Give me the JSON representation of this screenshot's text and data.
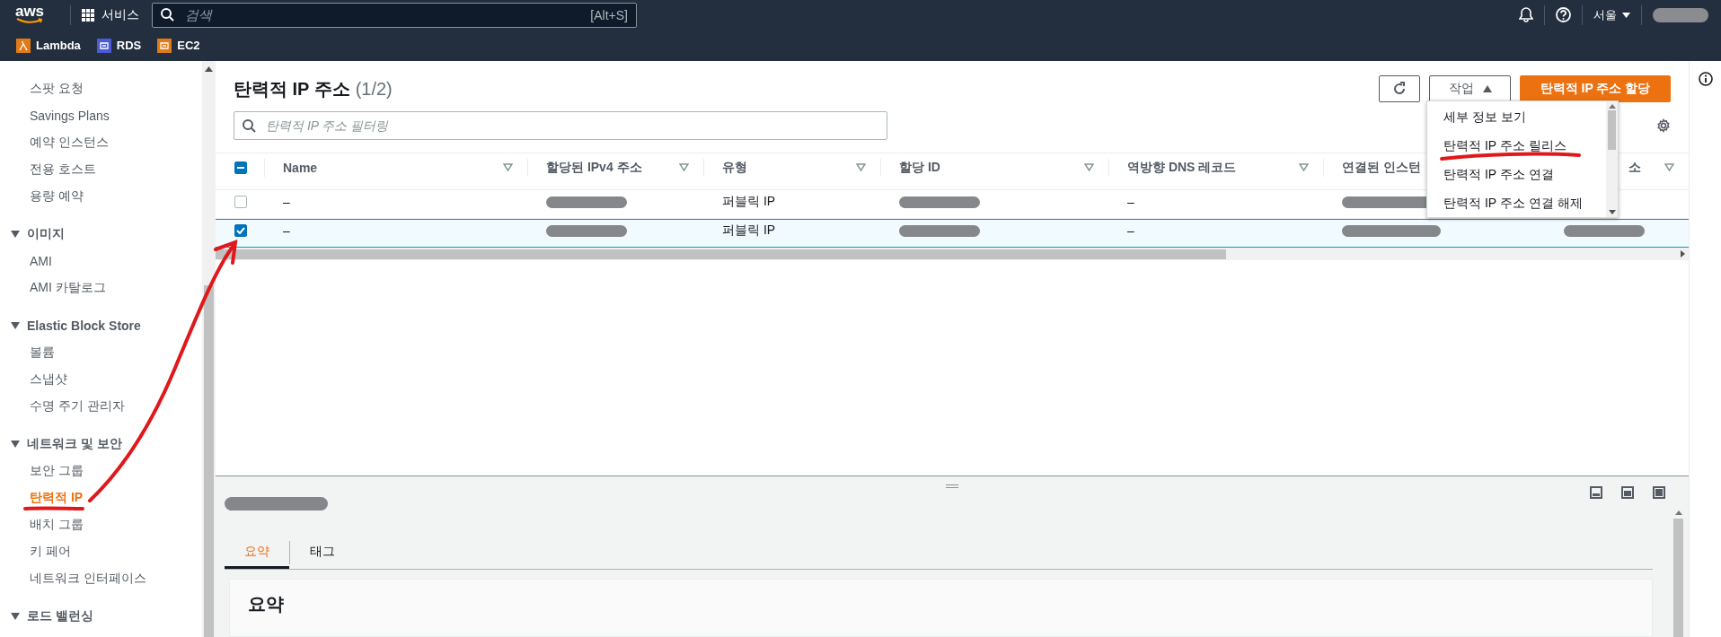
{
  "top_nav": {
    "logo": "aws",
    "services": "서비스",
    "search": {
      "placeholder": "검색",
      "shortcut": "[Alt+S]"
    },
    "region": "서울"
  },
  "favorites": [
    {
      "label": "Lambda",
      "color": "#e07b18"
    },
    {
      "label": "RDS",
      "color": "#4d5ad6"
    },
    {
      "label": "EC2",
      "color": "#e07b18"
    }
  ],
  "sidebar": {
    "items": [
      {
        "label": "스팟 요청",
        "selected": false
      },
      {
        "label": "Savings Plans",
        "selected": false
      },
      {
        "label": "예약 인스턴스",
        "selected": false
      },
      {
        "label": "전용 호스트",
        "selected": false
      },
      {
        "label": "용량 예약",
        "selected": false
      }
    ],
    "sections": [
      {
        "label": "이미지",
        "expanded": true,
        "items": [
          {
            "label": "AMI",
            "selected": false
          },
          {
            "label": "AMI 카탈로그",
            "selected": false
          }
        ]
      },
      {
        "label": "Elastic Block Store",
        "expanded": true,
        "items": [
          {
            "label": "볼륨",
            "selected": false
          },
          {
            "label": "스냅샷",
            "selected": false
          },
          {
            "label": "수명 주기 관리자",
            "selected": false
          }
        ]
      },
      {
        "label": "네트워크 및 보안",
        "expanded": true,
        "items": [
          {
            "label": "보안 그룹",
            "selected": false
          },
          {
            "label": "탄력적 IP",
            "selected": true
          },
          {
            "label": "배치 그룹",
            "selected": false
          },
          {
            "label": "키 페어",
            "selected": false
          },
          {
            "label": "네트워크 인터페이스",
            "selected": false
          }
        ]
      },
      {
        "label": "로드 밸런싱",
        "expanded": true
      }
    ]
  },
  "main": {
    "title": "탄력적 IP 주소",
    "count": "(1/2)",
    "actions_menu": {
      "label": "작업",
      "expanded": true,
      "items": [
        "세부 정보 보기",
        "탄력적 IP 주소 릴리스",
        "탄력적 IP 주소 연결",
        "탄력적 IP 주소 연결 해제"
      ]
    },
    "primary_button": "탄력적 IP 주소 할당",
    "filter": {
      "placeholder": "탄력적 IP 주소 필터링"
    },
    "table": {
      "select_all": {
        "indeterminate": true
      },
      "columns": [
        "Name",
        "할당된 IPv4 주소",
        "유형",
        "할당 ID",
        "역방향 DNS 레코드",
        "연결된 인스턴",
        "소"
      ],
      "rows": [
        {
          "selected": false,
          "cells": [
            {
              "kind": "text",
              "text": "–"
            },
            {
              "kind": "redacted"
            },
            {
              "kind": "text",
              "text": "퍼블릭 IP"
            },
            {
              "kind": "redacted"
            },
            {
              "kind": "text",
              "text": "–"
            },
            {
              "kind": "redacted"
            },
            {
              "kind": "empty"
            }
          ]
        },
        {
          "selected": true,
          "cells": [
            {
              "kind": "text",
              "text": "–"
            },
            {
              "kind": "redacted"
            },
            {
              "kind": "text",
              "text": "퍼블릭 IP"
            },
            {
              "kind": "redacted"
            },
            {
              "kind": "text",
              "text": "–"
            },
            {
              "kind": "redacted"
            },
            {
              "kind": "redacted"
            }
          ]
        }
      ]
    }
  },
  "detail_panel": {
    "title": {
      "kind": "redacted"
    },
    "tabs": [
      {
        "label": "요약",
        "selected": true
      },
      {
        "label": "태그",
        "selected": false
      }
    ],
    "heading": "요약"
  },
  "annotations": [
    {
      "kind": "arrow"
    },
    {
      "kind": "underline"
    },
    {
      "kind": "underline"
    }
  ]
}
